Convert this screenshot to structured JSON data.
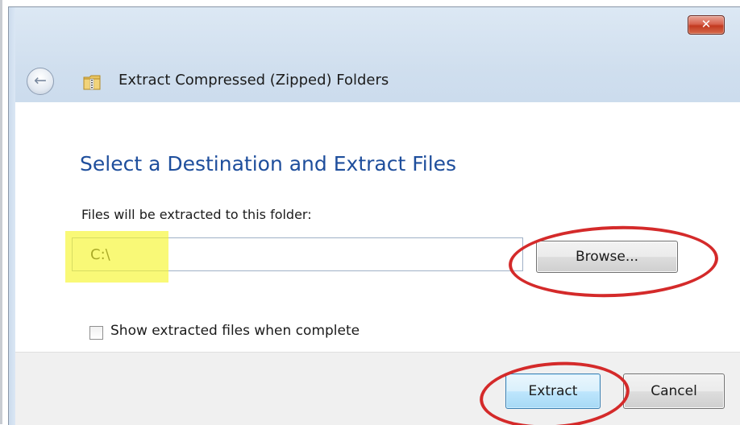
{
  "window": {
    "title": "Extract Compressed (Zipped) Folders",
    "close_label": "✕"
  },
  "content": {
    "heading": "Select a Destination and Extract Files",
    "folder_label": "Files will be extracted to this folder:",
    "path_value": "C:\\",
    "browse_label": "Browse...",
    "show_files_label": "Show extracted files when complete",
    "show_files_checked": false
  },
  "footer": {
    "extract_label": "Extract",
    "cancel_label": "Cancel"
  },
  "icons": {
    "back": "back-arrow-icon",
    "zip": "zip-folder-icon"
  },
  "colors": {
    "heading": "#1e4e9c",
    "annotation_circle": "#d42a2a",
    "highlight": "#f6f62e"
  }
}
